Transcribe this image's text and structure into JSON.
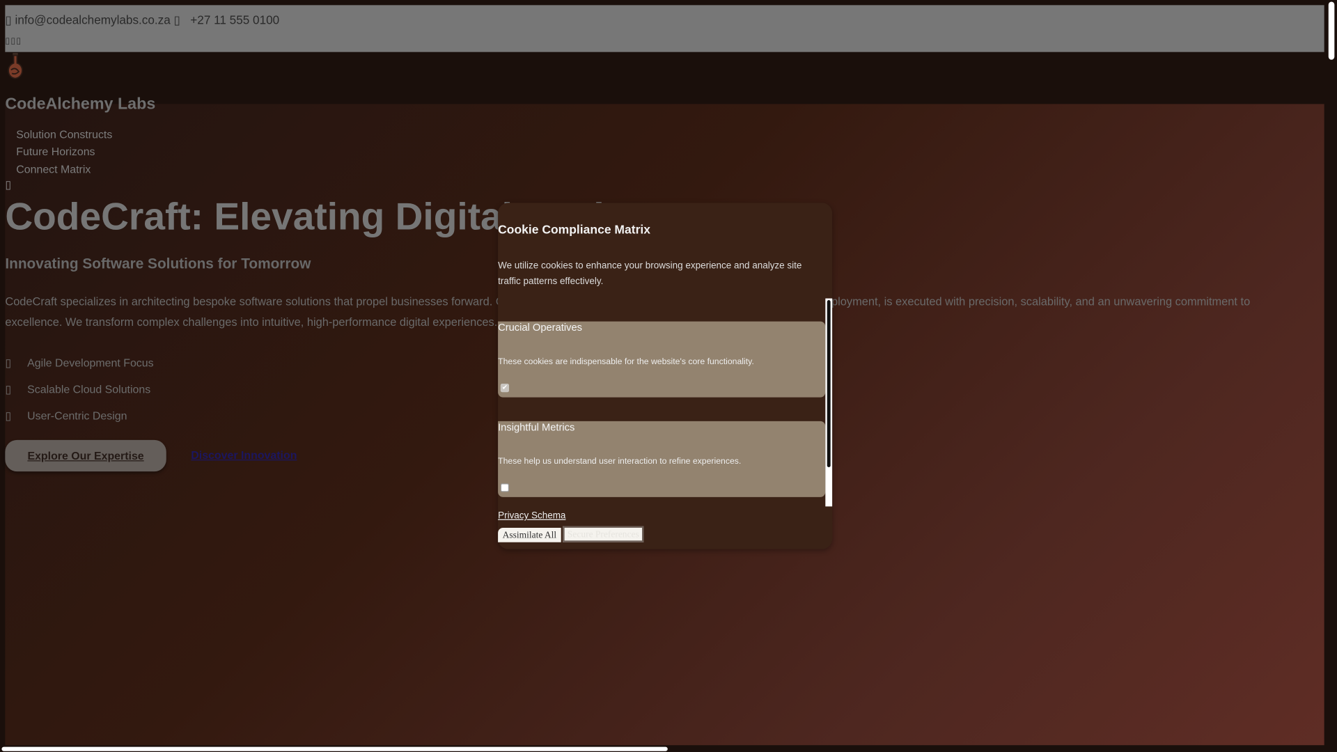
{
  "topbar": {
    "email": "info@codealchemylabs.co.za",
    "phone": "+27 11 555 0100",
    "social_icons": [
      "facebook-icon",
      "twitter-icon",
      "linkedin-icon"
    ]
  },
  "brand": {
    "name": "CodeAlchemy Labs"
  },
  "nav": {
    "items": [
      {
        "label": "Solution Constructs"
      },
      {
        "label": "Future Horizons"
      },
      {
        "label": "Connect Matrix"
      }
    ]
  },
  "hero": {
    "title": "CodeCraft: Elevating Digital Realms",
    "subtitle": "Innovating Software Solutions for Tomorrow",
    "paragraph": "CodeCraft specializes in architecting bespoke software solutions that propel businesses forward. Our dedicated team ensures that every project, from concept to deployment, is executed with precision, scalability, and an unwavering commitment to excellence. We transform complex challenges into intuitive, high-performance digital experiences.",
    "features": [
      {
        "label": "Agile Development Focus"
      },
      {
        "label": "Scalable Cloud Solutions"
      },
      {
        "label": "User-Centric Design"
      }
    ],
    "primary_button": "Explore Our Expertise",
    "secondary_link": "Discover Innovation"
  },
  "cookie": {
    "title": "Cookie Compliance Matrix",
    "description": "We utilize cookies to enhance your browsing experience and analyze site traffic patterns effectively.",
    "sections": [
      {
        "title": "Crucial Operatives",
        "description": "These cookies are indispensable for the website's core functionality.",
        "checked": true
      },
      {
        "title": "Insightful Metrics",
        "description": "These help us understand user interaction to refine experiences.",
        "checked": false
      }
    ],
    "privacy_link": "Privacy Schema",
    "accept_button": "Assimilate All",
    "save_button": "Secure Preferences"
  },
  "colors": {
    "topbar": "#777777",
    "modal": "#3a2216",
    "section": "#93836f",
    "link": "#1b1660"
  }
}
